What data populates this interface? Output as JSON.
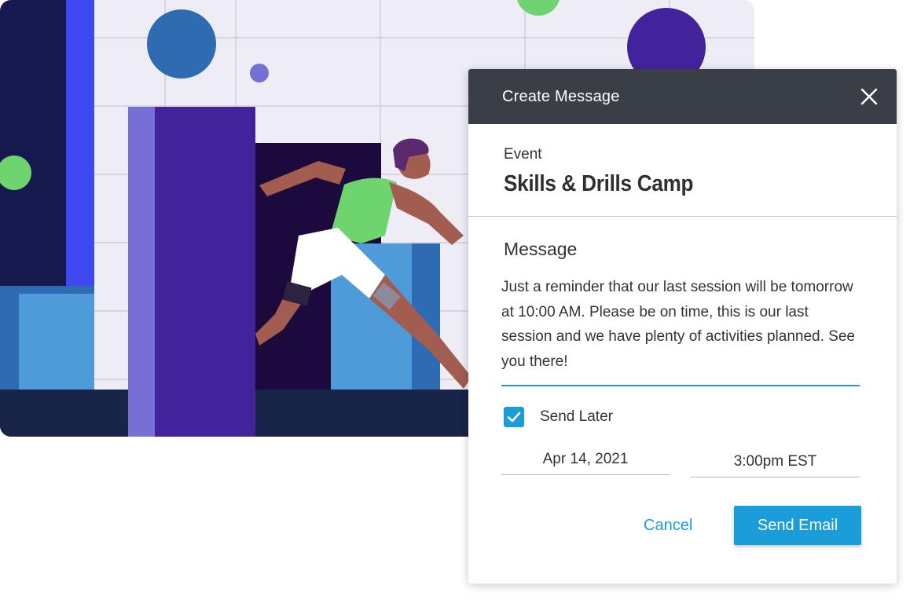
{
  "dialog": {
    "title": "Create Message",
    "event_label": "Event",
    "event_name": "Skills & Drills Camp",
    "message_label": "Message",
    "message_text": "Just a reminder that our last session will be tomorrow at 10:00 AM. Please be on time, this is our last session and we have plenty of activities planned. See you there!",
    "send_later_label": "Send Later",
    "send_later_checked": true,
    "date_value": "Apr 14, 2021",
    "time_value": "3:00pm EST",
    "cancel_label": "Cancel",
    "send_label": "Send Email"
  },
  "colors": {
    "accent": "#1a9dd9",
    "header_bg": "#3a3f47"
  },
  "icons": {
    "close": "close-icon",
    "check": "checkmark-icon"
  }
}
